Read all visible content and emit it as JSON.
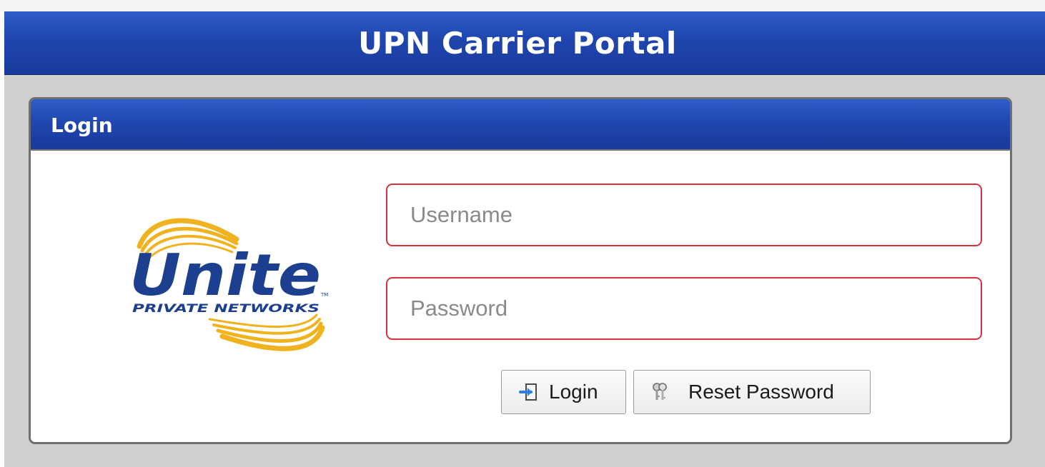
{
  "header": {
    "title": "UPN Carrier Portal"
  },
  "login_panel": {
    "title": "Login",
    "logo": {
      "icon": "unite-private-networks-logo",
      "name": "Unite",
      "tagline": "PRIVATE NETWORKS"
    },
    "username": {
      "placeholder": "Username",
      "value": ""
    },
    "password": {
      "placeholder": "Password",
      "value": ""
    },
    "buttons": {
      "login_label": "Login",
      "login_icon": "login-arrow-icon",
      "reset_label": "Reset Password",
      "reset_icon": "keys-icon"
    }
  },
  "colors": {
    "banner_blue": "#1f45ae",
    "input_border_error": "#d9323f",
    "logo_blue": "#1c3f8f",
    "logo_gold": "#f0b21f",
    "background_gray": "#cfcfcf"
  }
}
